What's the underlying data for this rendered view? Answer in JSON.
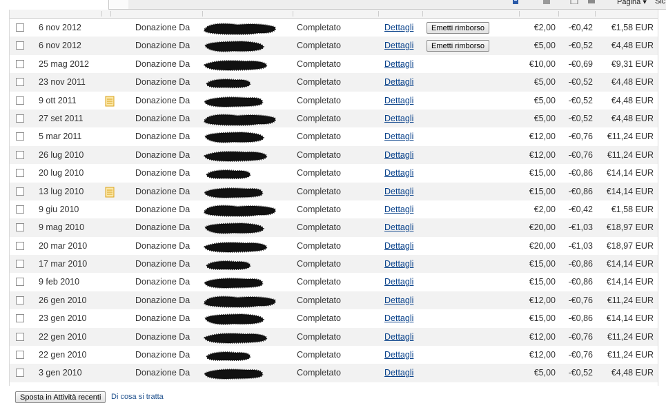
{
  "toolbar": {
    "page_label": "Pagina",
    "safety_label": "Sic"
  },
  "footer": {
    "move_button_label": "Sposta in Attività recenti",
    "help_link_label": "Di cosa si tratta"
  },
  "colors": {
    "link": "#08418a",
    "row_alt": "#f2f2f2",
    "note_icon": "#f2c55a"
  },
  "transactions": [
    {
      "date": "6 nov 2012",
      "note_icon": false,
      "type": "Donazione Da",
      "name_redacted": true,
      "status": "Completato",
      "details": "Dettagli",
      "refund_button": "Emetti rimborso",
      "gross": "€2,00",
      "fee": "-€0,42",
      "net": "€1,58 EUR"
    },
    {
      "date": "6 nov 2012",
      "note_icon": false,
      "type": "Donazione Da",
      "name_redacted": true,
      "status": "Completato",
      "details": "Dettagli",
      "refund_button": "Emetti rimborso",
      "gross": "€5,00",
      "fee": "-€0,52",
      "net": "€4,48 EUR"
    },
    {
      "date": "25 mag 2012",
      "note_icon": false,
      "type": "Donazione Da",
      "name_redacted": true,
      "status": "Completato",
      "details": "Dettagli",
      "refund_button": "",
      "gross": "€10,00",
      "fee": "-€0,69",
      "net": "€9,31 EUR"
    },
    {
      "date": "23 nov 2011",
      "note_icon": false,
      "type": "Donazione Da",
      "name_redacted": true,
      "status": "Completato",
      "details": "Dettagli",
      "refund_button": "",
      "gross": "€5,00",
      "fee": "-€0,52",
      "net": "€4,48 EUR"
    },
    {
      "date": "9 ott 2011",
      "note_icon": true,
      "type": "Donazione Da",
      "name_redacted": true,
      "status": "Completato",
      "details": "Dettagli",
      "refund_button": "",
      "gross": "€5,00",
      "fee": "-€0,52",
      "net": "€4,48 EUR"
    },
    {
      "date": "27 set 2011",
      "note_icon": false,
      "type": "Donazione Da",
      "name_redacted": true,
      "status": "Completato",
      "details": "Dettagli",
      "refund_button": "",
      "gross": "€5,00",
      "fee": "-€0,52",
      "net": "€4,48 EUR"
    },
    {
      "date": "5 mar 2011",
      "note_icon": false,
      "type": "Donazione Da",
      "name_redacted": true,
      "status": "Completato",
      "details": "Dettagli",
      "refund_button": "",
      "gross": "€12,00",
      "fee": "-€0,76",
      "net": "€11,24 EUR"
    },
    {
      "date": "26 lug 2010",
      "note_icon": false,
      "type": "Donazione Da",
      "name_redacted": true,
      "status": "Completato",
      "details": "Dettagli",
      "refund_button": "",
      "gross": "€12,00",
      "fee": "-€0,76",
      "net": "€11,24 EUR"
    },
    {
      "date": "20 lug 2010",
      "note_icon": false,
      "type": "Donazione Da",
      "name_redacted": true,
      "status": "Completato",
      "details": "Dettagli",
      "refund_button": "",
      "gross": "€15,00",
      "fee": "-€0,86",
      "net": "€14,14 EUR"
    },
    {
      "date": "13 lug 2010",
      "note_icon": true,
      "type": "Donazione Da",
      "name_redacted": true,
      "status": "Completato",
      "details": "Dettagli",
      "refund_button": "",
      "gross": "€15,00",
      "fee": "-€0,86",
      "net": "€14,14 EUR"
    },
    {
      "date": "9 giu 2010",
      "note_icon": false,
      "type": "Donazione Da",
      "name_redacted": true,
      "status": "Completato",
      "details": "Dettagli",
      "refund_button": "",
      "gross": "€2,00",
      "fee": "-€0,42",
      "net": "€1,58 EUR"
    },
    {
      "date": "9 mag 2010",
      "note_icon": false,
      "type": "Donazione Da",
      "name_redacted": true,
      "status": "Completato",
      "details": "Dettagli",
      "refund_button": "",
      "gross": "€20,00",
      "fee": "-€1,03",
      "net": "€18,97 EUR"
    },
    {
      "date": "20 mar 2010",
      "note_icon": false,
      "type": "Donazione Da",
      "name_redacted": true,
      "status": "Completato",
      "details": "Dettagli",
      "refund_button": "",
      "gross": "€20,00",
      "fee": "-€1,03",
      "net": "€18,97 EUR"
    },
    {
      "date": "17 mar 2010",
      "note_icon": false,
      "type": "Donazione Da",
      "name_redacted": true,
      "status": "Completato",
      "details": "Dettagli",
      "refund_button": "",
      "gross": "€15,00",
      "fee": "-€0,86",
      "net": "€14,14 EUR"
    },
    {
      "date": "9 feb 2010",
      "note_icon": false,
      "type": "Donazione Da",
      "name_redacted": true,
      "status": "Completato",
      "details": "Dettagli",
      "refund_button": "",
      "gross": "€15,00",
      "fee": "-€0,86",
      "net": "€14,14 EUR"
    },
    {
      "date": "26 gen 2010",
      "note_icon": false,
      "type": "Donazione Da",
      "name_redacted": true,
      "status": "Completato",
      "details": "Dettagli",
      "refund_button": "",
      "gross": "€12,00",
      "fee": "-€0,76",
      "net": "€11,24 EUR"
    },
    {
      "date": "23 gen 2010",
      "note_icon": false,
      "type": "Donazione Da",
      "name_redacted": true,
      "status": "Completato",
      "details": "Dettagli",
      "refund_button": "",
      "gross": "€15,00",
      "fee": "-€0,86",
      "net": "€14,14 EUR"
    },
    {
      "date": "22 gen 2010",
      "note_icon": false,
      "type": "Donazione Da",
      "name_redacted": true,
      "status": "Completato",
      "details": "Dettagli",
      "refund_button": "",
      "gross": "€12,00",
      "fee": "-€0,76",
      "net": "€11,24 EUR"
    },
    {
      "date": "22 gen 2010",
      "note_icon": false,
      "type": "Donazione Da",
      "name_redacted": true,
      "status": "Completato",
      "details": "Dettagli",
      "refund_button": "",
      "gross": "€12,00",
      "fee": "-€0,76",
      "net": "€11,24 EUR"
    },
    {
      "date": "3 gen 2010",
      "note_icon": false,
      "type": "Donazione Da",
      "name_redacted": true,
      "status": "Completato",
      "details": "Dettagli",
      "refund_button": "",
      "gross": "€5,00",
      "fee": "-€0,52",
      "net": "€4,48 EUR"
    }
  ]
}
